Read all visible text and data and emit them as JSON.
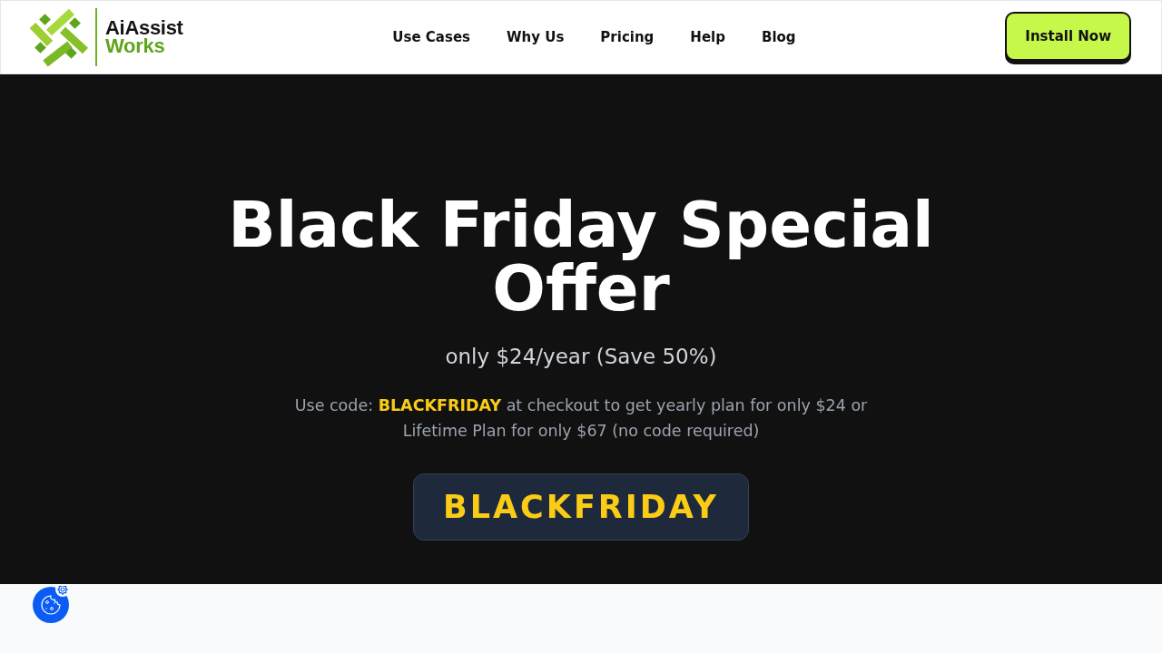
{
  "header": {
    "logo": {
      "line_1": "AiAssist",
      "line_2": "Works"
    },
    "nav": [
      "Use Cases",
      "Why Us",
      "Pricing",
      "Help",
      "Blog"
    ],
    "cta": "Install Now"
  },
  "hero": {
    "title": "Black Friday Special Offer",
    "subtitle": "only $24/year (Save 50%)",
    "description": "Use code: **BLACKFRIDAY** at checkout to get yearly plan for only $24 or Lifetime Plan for only $67 (no code required)",
    "code": "BLACKFRIDAY"
  }
}
